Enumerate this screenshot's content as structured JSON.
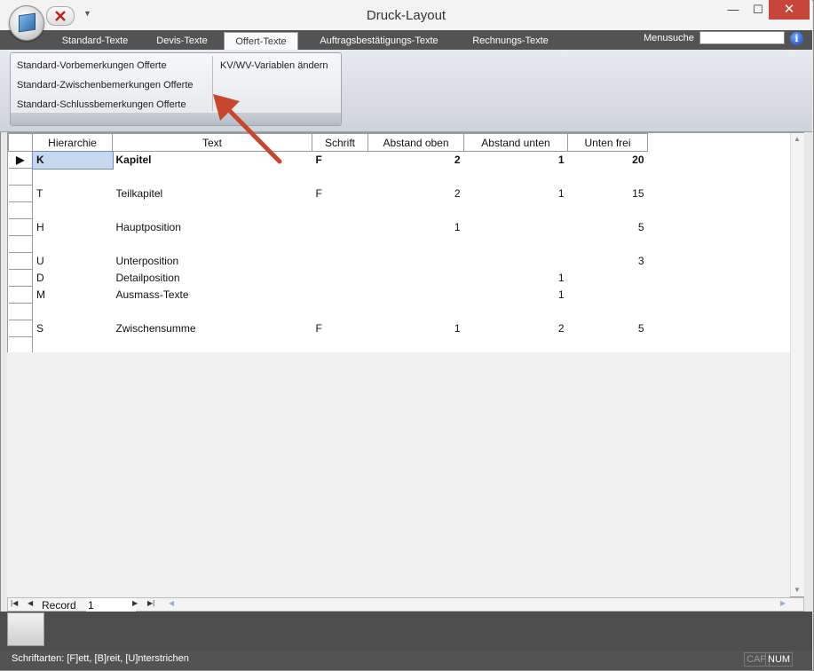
{
  "window": {
    "title": "Druck-Layout"
  },
  "tabs": [
    {
      "label": "Standard-Texte"
    },
    {
      "label": "Devis-Texte"
    },
    {
      "label": "Offert-Texte"
    },
    {
      "label": "Auftragsbestätigungs-Texte"
    },
    {
      "label": "Rechnungs-Texte"
    }
  ],
  "active_tab": "Offert-Texte",
  "menusuche": {
    "label": "Menusuche",
    "value": ""
  },
  "ribbon": {
    "items": [
      "Standard-Vorbemerkungen Offerte",
      "Standard-Zwischenbemerkungen Offerte",
      "Standard-Schlussbemerkungen Offerte",
      "KV/WV-Variablen ändern"
    ]
  },
  "grid": {
    "columns": [
      "Hierarchie",
      "Text",
      "Schrift",
      "Abstand oben",
      "Abstand unten",
      "Unten frei"
    ],
    "rows": [
      {
        "hierarchie": "K",
        "text": "Kapitel",
        "schrift": "F",
        "oben": "2",
        "unten": "1",
        "frei": "20",
        "bold": true
      },
      {
        "hierarchie": "",
        "text": "",
        "schrift": "",
        "oben": "",
        "unten": "",
        "frei": ""
      },
      {
        "hierarchie": "T",
        "text": "Teilkapitel",
        "schrift": "F",
        "oben": "2",
        "unten": "1",
        "frei": "15"
      },
      {
        "hierarchie": "",
        "text": "",
        "schrift": "",
        "oben": "",
        "unten": "",
        "frei": ""
      },
      {
        "hierarchie": "H",
        "text": "Hauptposition",
        "schrift": "",
        "oben": "1",
        "unten": "",
        "frei": "5"
      },
      {
        "hierarchie": "",
        "text": "",
        "schrift": "",
        "oben": "",
        "unten": "",
        "frei": ""
      },
      {
        "hierarchie": "U",
        "text": "Unterposition",
        "schrift": "",
        "oben": "",
        "unten": "",
        "frei": "3"
      },
      {
        "hierarchie": "D",
        "text": "Detailposition",
        "schrift": "",
        "oben": "",
        "unten": "1",
        "frei": ""
      },
      {
        "hierarchie": "M",
        "text": "Ausmass-Texte",
        "schrift": "",
        "oben": "",
        "unten": "1",
        "frei": ""
      },
      {
        "hierarchie": "",
        "text": "",
        "schrift": "",
        "oben": "",
        "unten": "",
        "frei": ""
      },
      {
        "hierarchie": "S",
        "text": "Zwischensumme",
        "schrift": "F",
        "oben": "1",
        "unten": "2",
        "frei": "5"
      },
      {
        "hierarchie": "",
        "text": "",
        "schrift": "",
        "oben": "",
        "unten": "",
        "frei": ""
      }
    ]
  },
  "record_nav": {
    "label": "Record",
    "value": "1"
  },
  "status": {
    "text": "Schriftarten: [F]ett,  [B]reit,  [U]nterstrichen",
    "cap": "CAP",
    "num": "NUM"
  },
  "colors": {
    "tab_bar": "#535353",
    "close_button": "#c7463a",
    "annotation_arrow": "#c8452e",
    "selected_cell": "#c6d9f1"
  }
}
